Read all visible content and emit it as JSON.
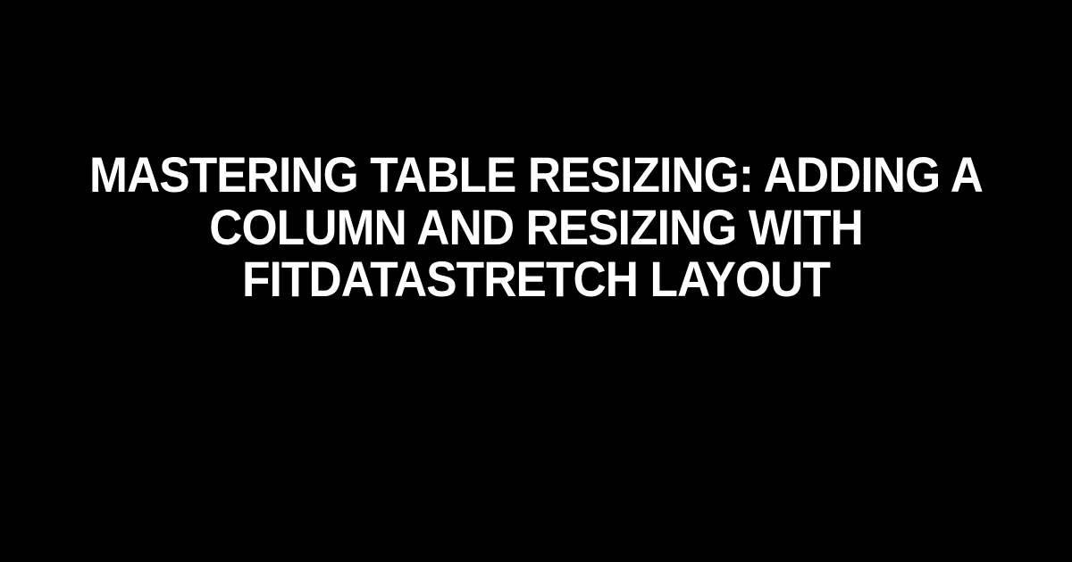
{
  "title": "Mastering Table Resizing: Adding a Column and Resizing with fitDataStretch Layout"
}
